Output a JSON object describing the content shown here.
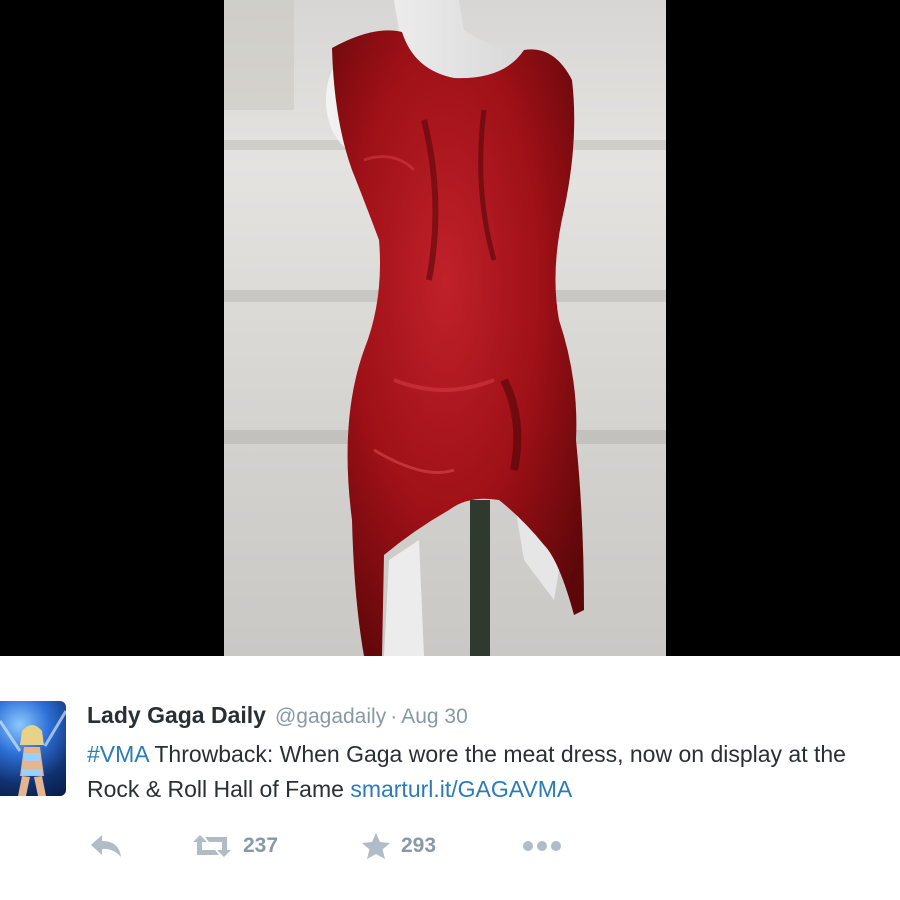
{
  "tweet": {
    "author_name": "Lady Gaga Daily",
    "handle": "@gagadaily",
    "separator": "·",
    "timestamp": "Aug 30",
    "hashtag": "#VMA",
    "text_part1": " Throwback: When Gaga wore the meat dress, now on display at the Rock & Roll Hall of Fame ",
    "link": "smarturl.it/GAGAVMA"
  },
  "actions": {
    "reply": {
      "icon": "reply-icon"
    },
    "retweet": {
      "icon": "retweet-icon",
      "count": "237"
    },
    "favorite": {
      "icon": "star-icon",
      "count": "293"
    },
    "more": {
      "icon": "more-icon"
    }
  },
  "colors": {
    "link": "#2b7bb9",
    "meta": "#8899a6",
    "text": "#292f33",
    "icon": "#b0bcc6"
  }
}
